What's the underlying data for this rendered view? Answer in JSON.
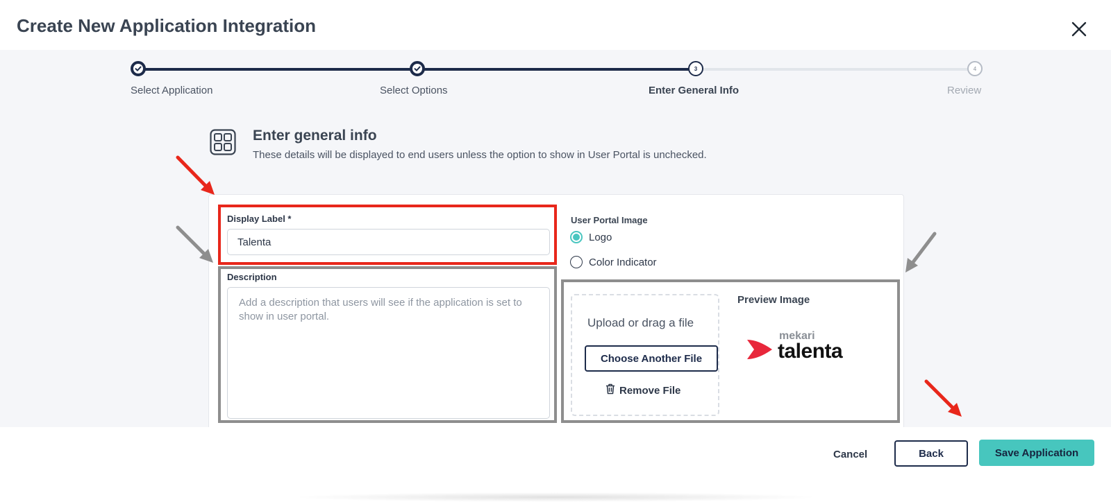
{
  "header": {
    "title": "Create New Application Integration",
    "close_icon": "close-icon"
  },
  "stepper": {
    "steps": [
      {
        "label": "Select Application",
        "status": "done",
        "number": "1"
      },
      {
        "label": "Select Options",
        "status": "done",
        "number": "2"
      },
      {
        "label": "Enter General Info",
        "status": "current",
        "number": "3"
      },
      {
        "label": "Review",
        "status": "future",
        "number": "4"
      }
    ]
  },
  "section": {
    "title": "Enter general info",
    "description": "These details will be displayed to end users unless the option to show in User Portal is unchecked.",
    "icon": "grid-apps-icon"
  },
  "form": {
    "display_label": {
      "label": "Display Label *",
      "value": "Talenta"
    },
    "description": {
      "label": "Description",
      "placeholder": "Add a description that users will see if the application is set to show in user portal."
    },
    "user_portal_image": {
      "label": "User Portal Image",
      "options": [
        {
          "label": "Logo",
          "checked": true
        },
        {
          "label": "Color Indicator",
          "checked": false
        }
      ]
    },
    "upload": {
      "drop_text": "Upload or drag a file",
      "choose_label": "Choose Another File",
      "remove_label": "Remove File"
    },
    "preview": {
      "title": "Preview Image",
      "logo_small": "mekari",
      "logo_big": "talenta"
    }
  },
  "footer": {
    "cancel_label": "Cancel",
    "back_label": "Back",
    "save_label": "Save Application"
  },
  "colors": {
    "accent": "#47c6be",
    "navy": "#1d2b4a",
    "annotation_red": "#e8271b",
    "annotation_gray": "#8e8e8e"
  }
}
